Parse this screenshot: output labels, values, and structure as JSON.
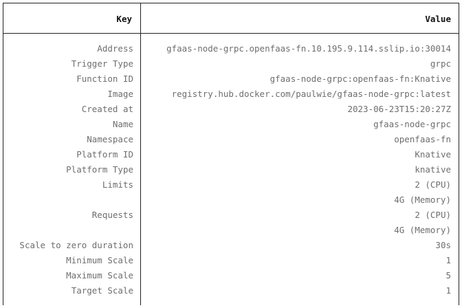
{
  "table": {
    "headers": {
      "key": "Key",
      "value": "Value"
    },
    "rows": [
      {
        "key": "Address",
        "value": "gfaas-node-grpc.openfaas-fn.10.195.9.114.sslip.io:30014"
      },
      {
        "key": "Trigger Type",
        "value": "grpc"
      },
      {
        "key": "Function ID",
        "value": "gfaas-node-grpc:openfaas-fn:Knative"
      },
      {
        "key": "Image",
        "value": "registry.hub.docker.com/paulwie/gfaas-node-grpc:latest"
      },
      {
        "key": "Created at",
        "value": "2023-06-23T15:20:27Z"
      },
      {
        "key": "Name",
        "value": "gfaas-node-grpc"
      },
      {
        "key": "Namespace",
        "value": "openfaas-fn"
      },
      {
        "key": "Platform ID",
        "value": "Knative"
      },
      {
        "key": "Platform Type",
        "value": "knative"
      },
      {
        "key": "Limits",
        "value": "2 (CPU)"
      },
      {
        "key": "",
        "value": "4G (Memory)"
      },
      {
        "key": "Requests",
        "value": "2 (CPU)"
      },
      {
        "key": "",
        "value": "4G (Memory)"
      },
      {
        "key": "Scale to zero duration",
        "value": "30s"
      },
      {
        "key": "Minimum Scale",
        "value": "1"
      },
      {
        "key": "Maximum Scale",
        "value": "5"
      },
      {
        "key": "Target Scale",
        "value": "1"
      }
    ]
  }
}
